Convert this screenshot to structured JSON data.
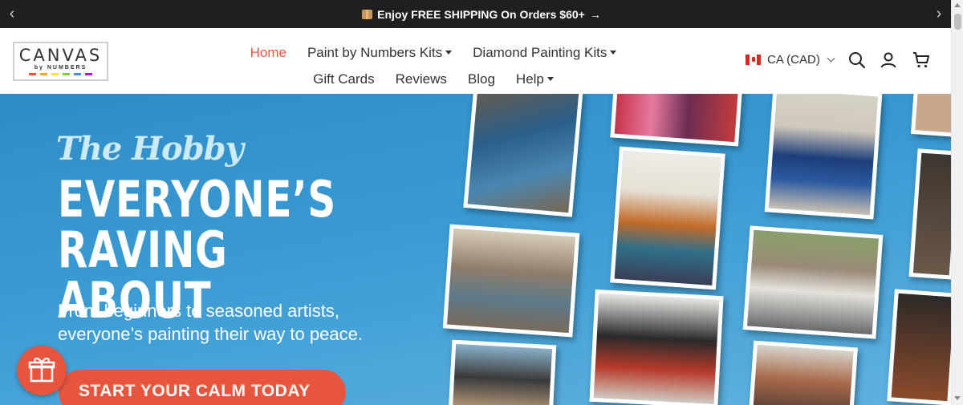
{
  "announcement": {
    "text": "Enjoy FREE SHIPPING On Orders $60+",
    "prev_icon": "chevron-left-icon",
    "next_icon": "chevron-right-icon",
    "arrow": "→"
  },
  "logo": {
    "word": "CANVAS",
    "sub": "by NUMBERS",
    "stripe_colors": [
      "#e8553f",
      "#f5a623",
      "#f8e71c",
      "#7ed321",
      "#4a90e2",
      "#bd10e0"
    ]
  },
  "nav": {
    "row1": [
      {
        "label": "Home",
        "active": true,
        "dropdown": false
      },
      {
        "label": "Paint by Numbers Kits",
        "active": false,
        "dropdown": true
      },
      {
        "label": "Diamond Painting Kits",
        "active": false,
        "dropdown": true
      }
    ],
    "row2": [
      {
        "label": "Gift Cards",
        "dropdown": false
      },
      {
        "label": "Reviews",
        "dropdown": false
      },
      {
        "label": "Blog",
        "dropdown": false
      },
      {
        "label": "Help",
        "dropdown": true
      }
    ]
  },
  "currency": {
    "label": "CA (CAD)",
    "flag": "canada-flag-icon"
  },
  "icons": [
    "search-icon",
    "account-icon",
    "cart-icon"
  ],
  "hero": {
    "tagline": "The Hobby",
    "headline_1": "EVERYONE’S",
    "headline_2": "RAVING ABOUT",
    "subtext_1": "From beginners to seasoned artists,",
    "subtext_2": "everyone’s painting their way to peace.",
    "cta": "START YOUR CALM TODAY"
  },
  "colors": {
    "accent": "#e8553f",
    "hero_blue": "#3a9bd3",
    "topbar": "#1f1f1f"
  },
  "gift_button_icon": "gift-icon"
}
